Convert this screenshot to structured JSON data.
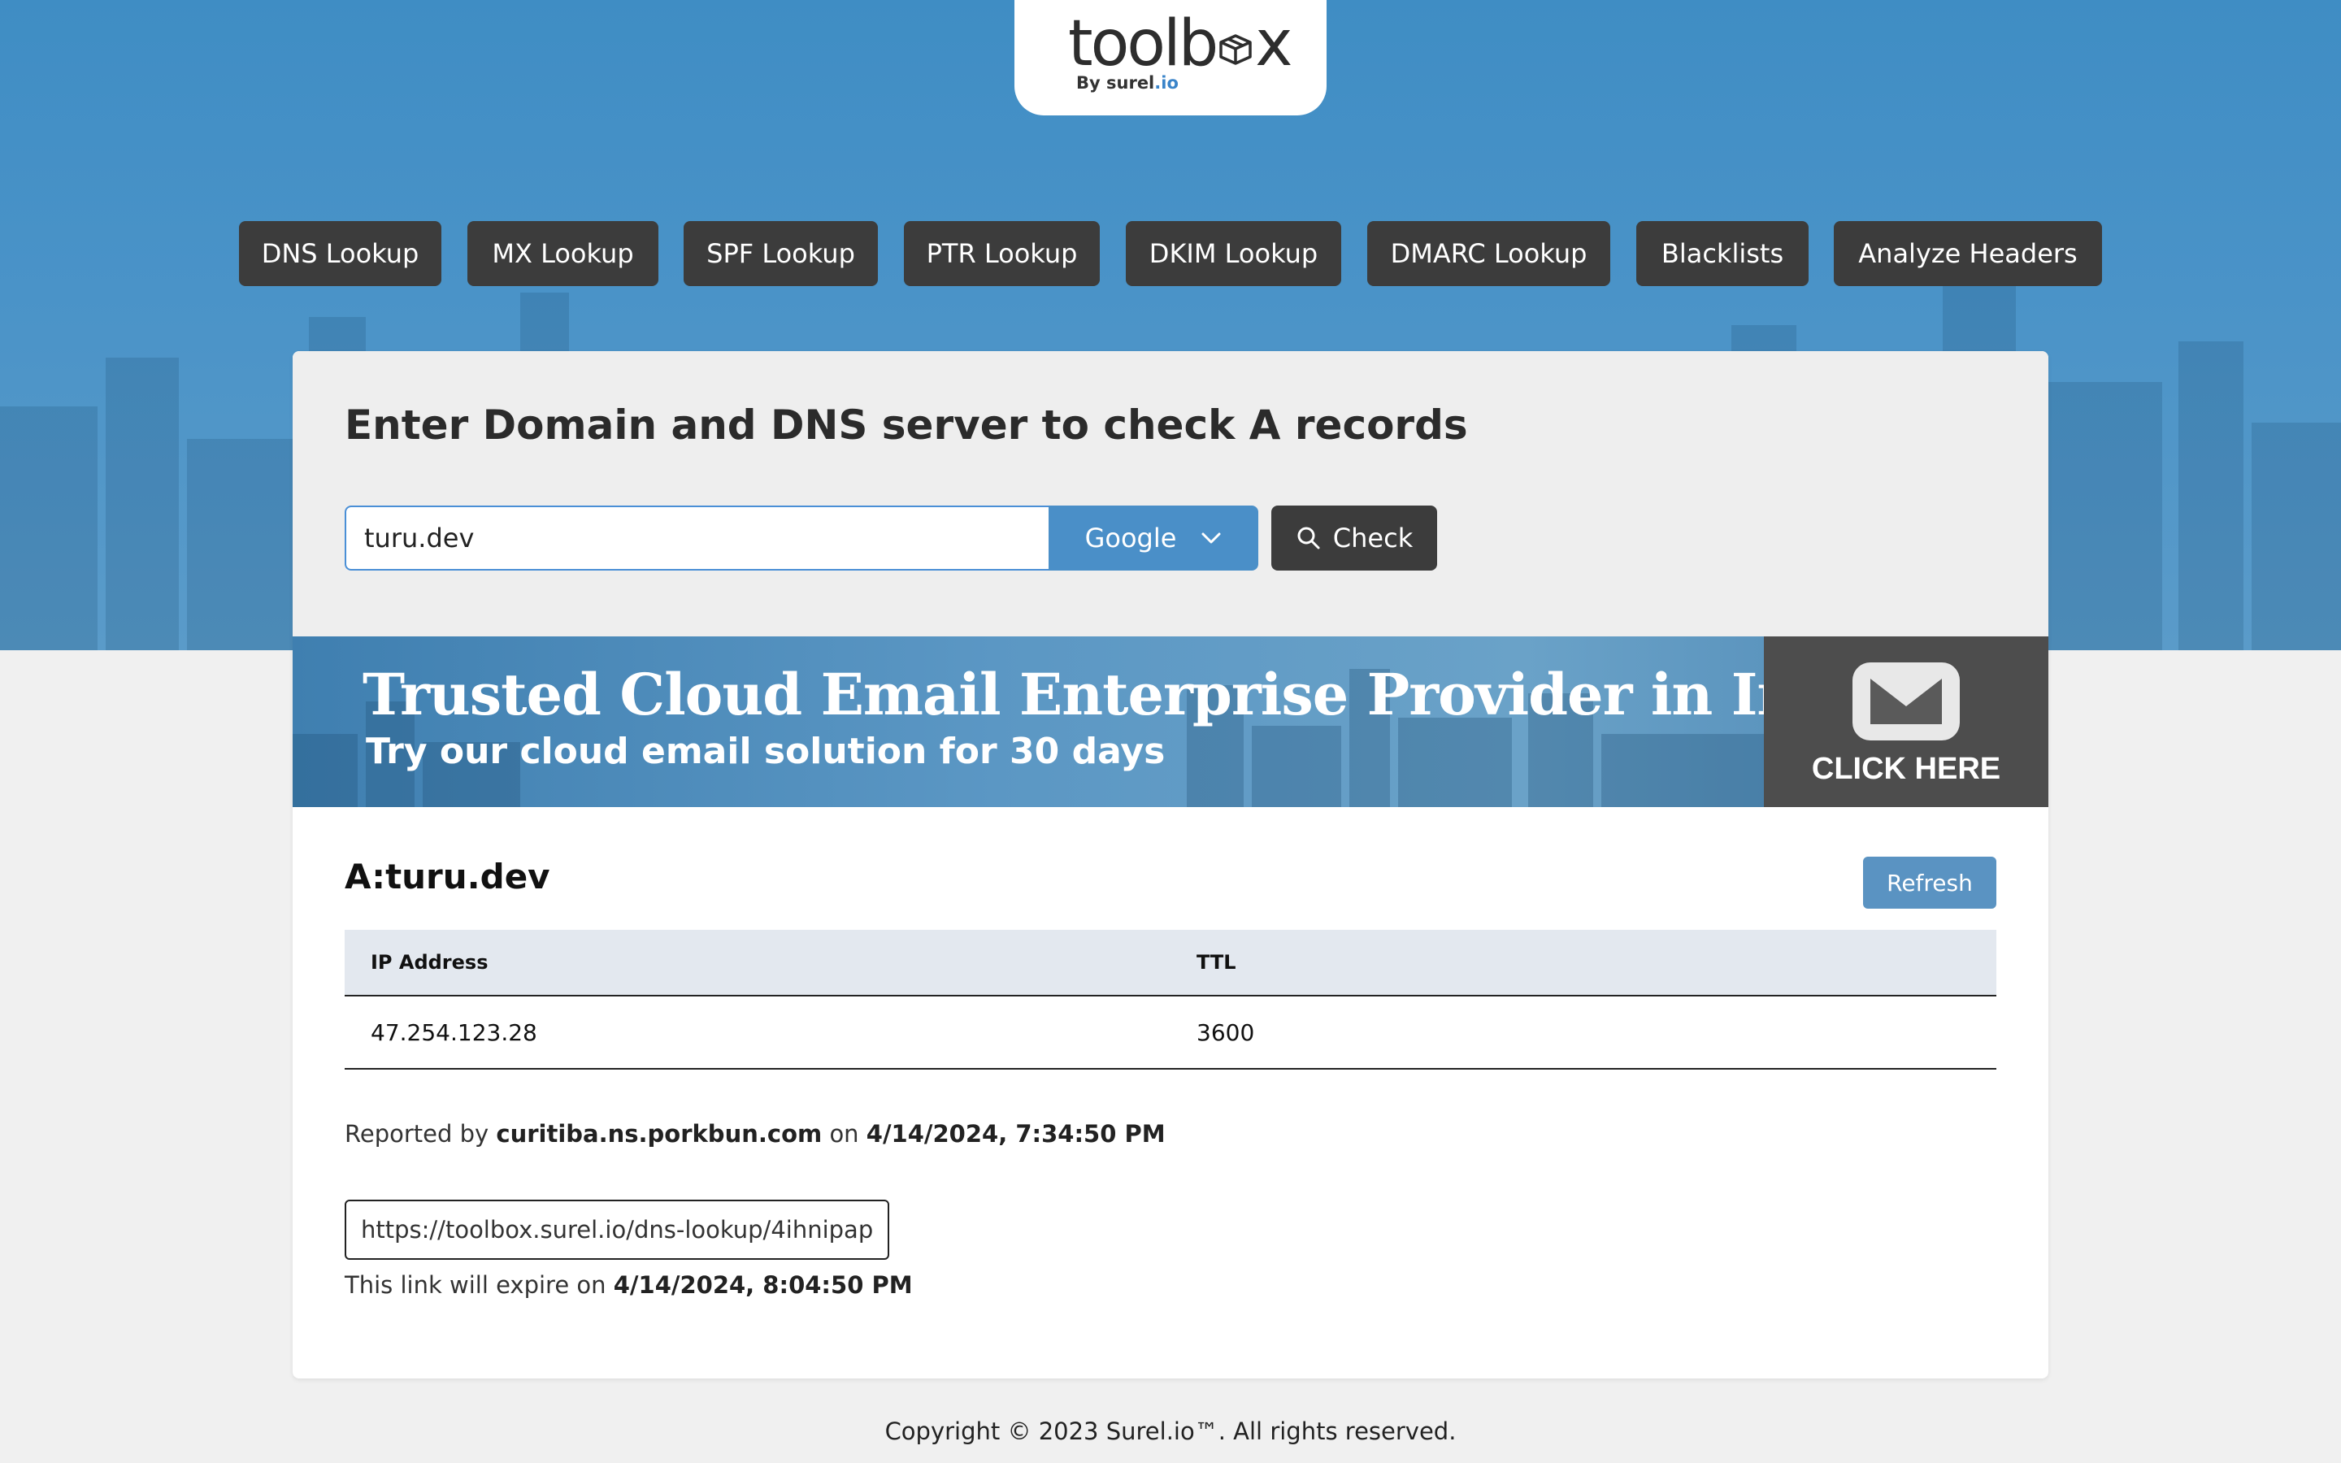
{
  "logo": {
    "text_before": "toolb",
    "text_after": "x",
    "icon": "box-icon",
    "sub_prefix": "By surel",
    "sub_accent": ".io"
  },
  "nav": {
    "items": [
      {
        "label": "DNS Lookup"
      },
      {
        "label": "MX Lookup"
      },
      {
        "label": "SPF Lookup"
      },
      {
        "label": "PTR Lookup"
      },
      {
        "label": "DKIM Lookup"
      },
      {
        "label": "DMARC Lookup"
      },
      {
        "label": "Blacklists"
      },
      {
        "label": "Analyze Headers"
      }
    ]
  },
  "form": {
    "title": "Enter Domain and DNS server to check A records",
    "domain_value": "turu.dev",
    "dns_server": "Google",
    "check_label": "Check"
  },
  "banner": {
    "title": "Trusted Cloud Email Enterprise Provider in Indonesia",
    "subtitle": "Try our cloud email solution for 30 days",
    "cta": "CLICK HERE"
  },
  "result": {
    "title": "A:turu.dev",
    "refresh_label": "Refresh",
    "columns": [
      "IP Address",
      "TTL"
    ],
    "rows": [
      {
        "ip": "47.254.123.28",
        "ttl": "3600"
      }
    ],
    "reported_prefix": "Reported by",
    "reported_server": "curitiba.ns.porkbun.com",
    "reported_on": "on",
    "reported_time": "4/14/2024, 7:34:50 PM",
    "share_link": "https://toolbox.surel.io/dns-lookup/4ihnipap",
    "expire_prefix": "This link will expire on",
    "expire_time": "4/14/2024, 8:04:50 PM"
  },
  "footer": {
    "copyright": "Copyright © 2023 Surel.io™. All rights reserved."
  },
  "colors": {
    "hero_blue": "#4a93c8",
    "nav_dark": "#3c3c3c",
    "select_blue": "#4a8fc8",
    "refresh_blue": "#5a93c2",
    "accent": "#3a84c9"
  }
}
